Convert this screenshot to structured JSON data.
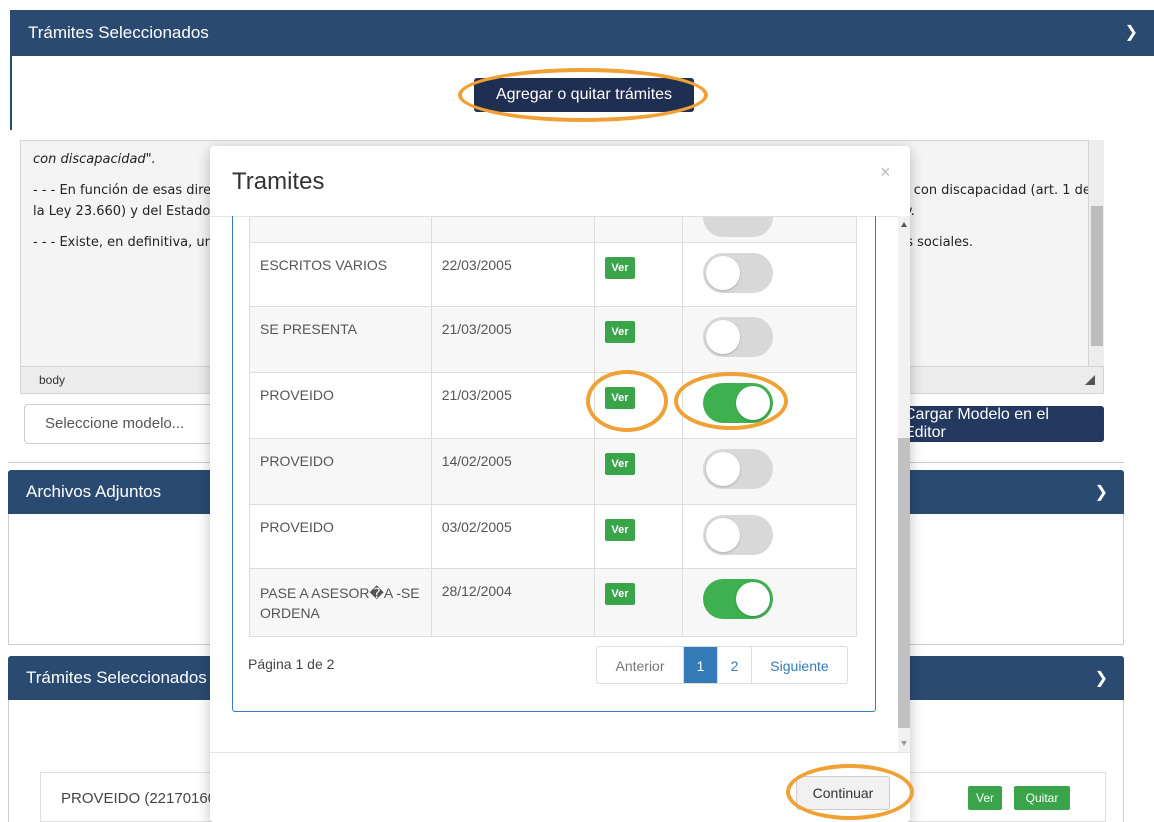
{
  "top_panel": {
    "title": "Trámites Seleccionados",
    "add_remove_label": "Agregar o quitar trámites"
  },
  "editor": {
    "paragraphs": [
      "con discapacidad\".",
      "- - - En función de esas directrices, la Ley 24.901 crea un sistema de prestaciones básicas de atención integral a favor de las personas con discapacidad (art. 1 de la Ley 23.660) y del Estado, a través de sus organismos, garantiza la universalidad de las prestaciones básicas comprendidas en la ley.",
      "- - - Existe, en definitiva, una obligación legal de cobertura establecida en la ley 24.901, el que se traslada en igual manera a las obras sociales."
    ],
    "status": "body"
  },
  "model_select": {
    "placeholder": "Seleccione modelo..."
  },
  "load_model_label": "Cargar Modelo en el Editor",
  "attachments_panel": {
    "title": "Archivos Adjuntos"
  },
  "selected_panel": {
    "title": "Trámites Seleccionados",
    "row_text": "PROVEIDO (22170160)",
    "ver_label": "Ver",
    "remove_label": "Quitar"
  },
  "modal": {
    "title": "Tramites",
    "close_glyph": "×",
    "rows": [
      {
        "name": "ESCRITOS VARIOS",
        "date": "22/03/2005",
        "ver": "Ver",
        "selected": false
      },
      {
        "name": "SE PRESENTA",
        "date": "21/03/2005",
        "ver": "Ver",
        "selected": false
      },
      {
        "name": "PROVEIDO",
        "date": "21/03/2005",
        "ver": "Ver",
        "selected": true
      },
      {
        "name": "PROVEIDO",
        "date": "14/02/2005",
        "ver": "Ver",
        "selected": false
      },
      {
        "name": "PROVEIDO",
        "date": "03/02/2005",
        "ver": "Ver",
        "selected": false
      },
      {
        "name": "PASE A ASESOR�A -SE ORDENA",
        "date": "28/12/2004",
        "ver": "Ver",
        "selected": true
      }
    ],
    "pager": {
      "info": "Página 1 de 2",
      "prev": "Anterior",
      "current": "1",
      "page2": "2",
      "next": "Siguiente"
    },
    "continue_label": "Continuar"
  },
  "colors": {
    "navy": "#2b4a72",
    "green": "#3fb04f",
    "highlight": "#f0a034",
    "link": "#337ab7"
  },
  "icons": {
    "panel_toggle": "chevron-down-icon"
  }
}
